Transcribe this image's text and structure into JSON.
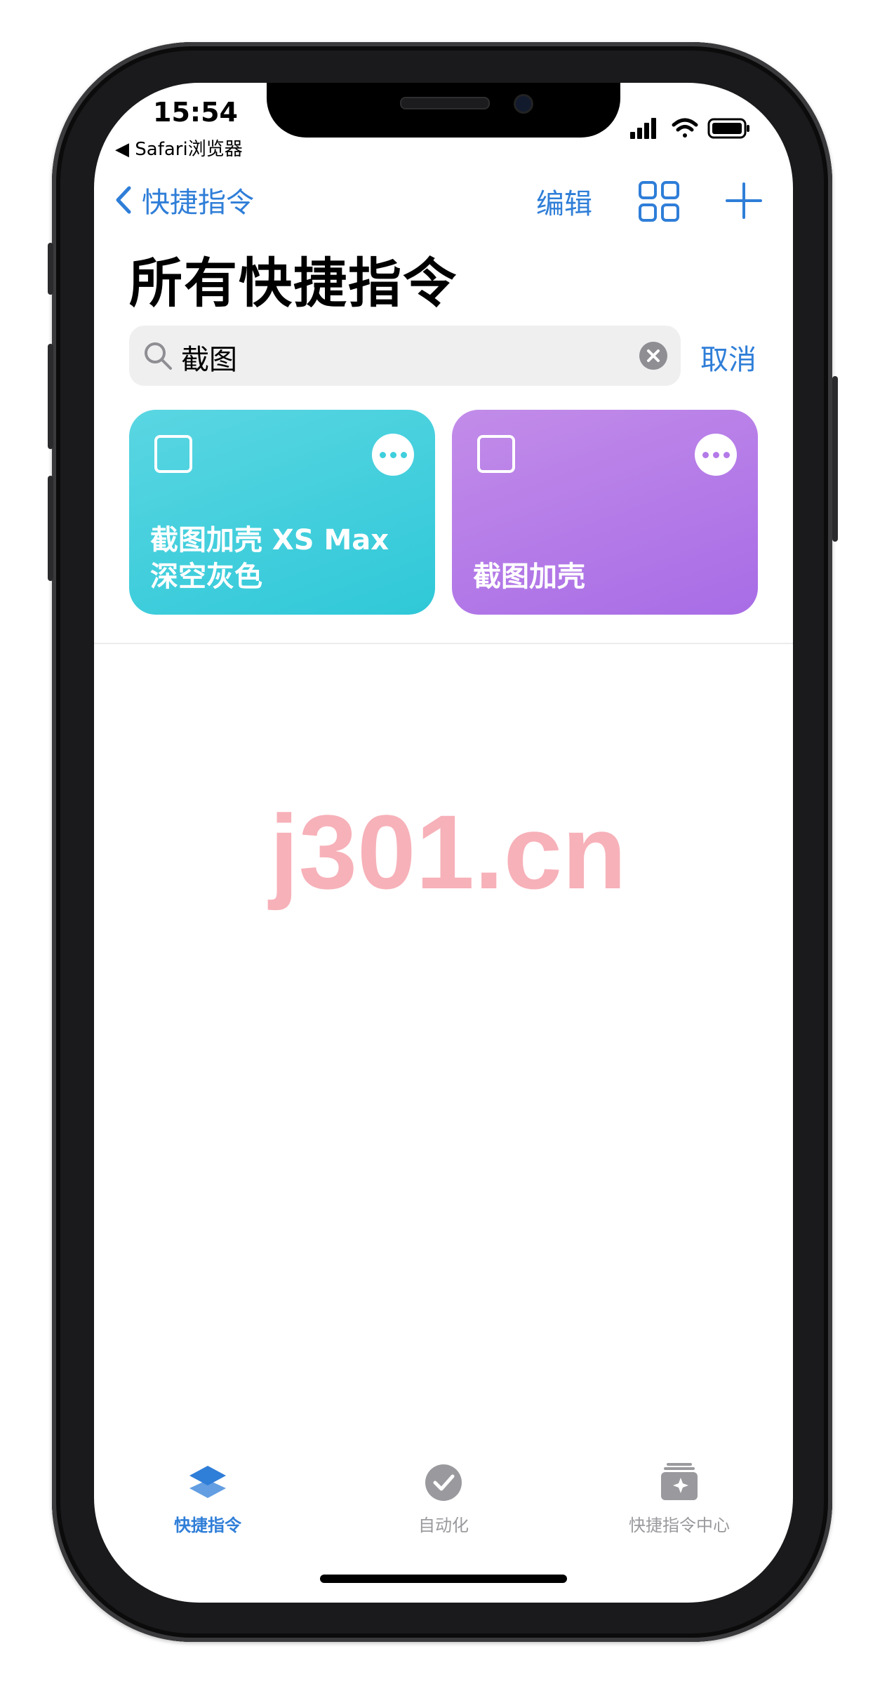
{
  "status_bar": {
    "time": "15:54",
    "back_app": "◀ Safari浏览器"
  },
  "nav": {
    "back_label": "快捷指令",
    "edit_label": "编辑"
  },
  "page": {
    "title": "所有快捷指令"
  },
  "search": {
    "value": "截图",
    "cancel_label": "取消"
  },
  "cards": [
    {
      "title_line1": "截图加壳 XS Max",
      "title_line2": "深空灰色",
      "color": "#3fcfdd"
    },
    {
      "title_line1": "",
      "title_line2": "截图加壳",
      "color": "#b47ae8"
    }
  ],
  "watermark": "j301.cn",
  "tabs": [
    {
      "label": "快捷指令",
      "icon": "layers-icon",
      "active": true
    },
    {
      "label": "自动化",
      "icon": "clock-check-icon",
      "active": false
    },
    {
      "label": "快捷指令中心",
      "icon": "gallery-icon",
      "active": false
    }
  ],
  "colors": {
    "accent": "#2f7ed8",
    "inactive": "#9a9a9e"
  }
}
